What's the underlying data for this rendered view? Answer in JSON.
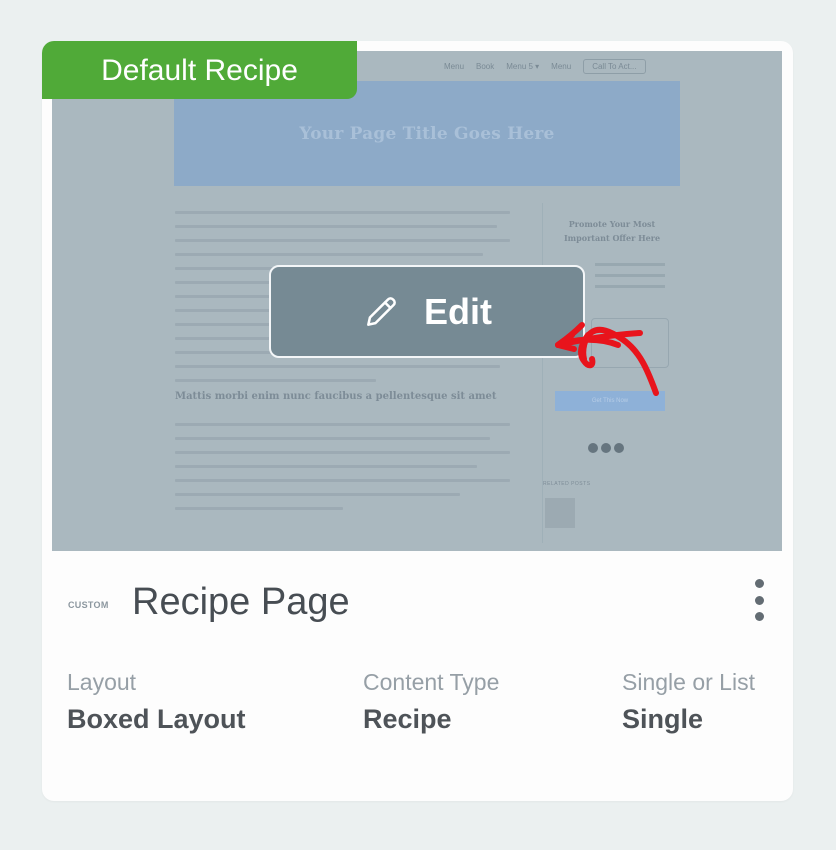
{
  "badge": "Default Recipe",
  "preview": {
    "nav": [
      "Menu",
      "Book",
      "Menu 5 ▾",
      "Menu"
    ],
    "nav_cta": "Call To Act...",
    "hero_title": "Your Page Title Goes Here",
    "subheading": "Mattis morbi enim nunc faucibus a pellentesque sit amet",
    "sidebar_title": "Promote Your Most Important Offer Here",
    "sidebar_button": "Get This Now",
    "related_label": "RELATED POSTS",
    "edit_label": "Edit"
  },
  "icons": {
    "edit": "pencil-icon",
    "pointer": "hand-drawn-arrow-icon",
    "menu": "vertical-dots-icon"
  },
  "card": {
    "tag": "CUSTOM",
    "title": "Recipe Page",
    "meta": [
      {
        "label": "Layout",
        "value": "Boxed Layout"
      },
      {
        "label": "Content Type",
        "value": "Recipe"
      },
      {
        "label": "Single or List",
        "value": "Single"
      }
    ]
  },
  "colors": {
    "badge": "#50aa38",
    "overlay": "#768a94",
    "arrow": "#e8141c",
    "text_dark": "#474d53",
    "text_muted": "#969fa6"
  }
}
